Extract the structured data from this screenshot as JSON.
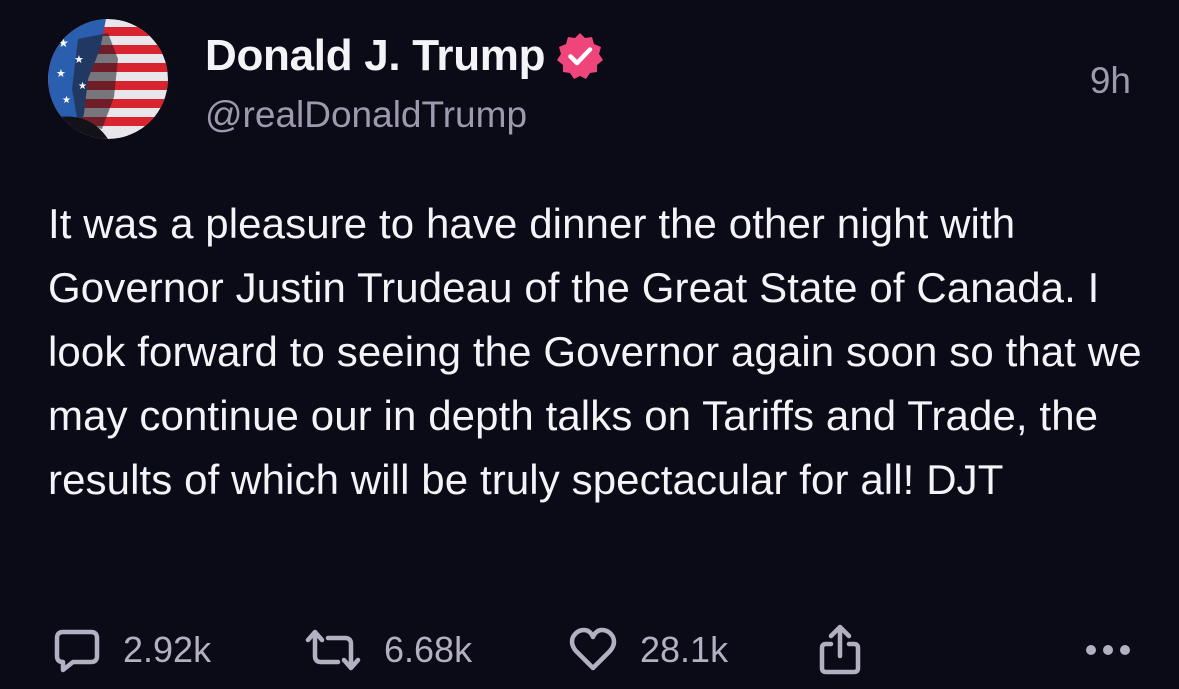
{
  "post": {
    "author": {
      "display_name": "Donald J. Trump",
      "handle": "@realDonaldTrump",
      "verified": true
    },
    "time": "9h",
    "text": "It was a pleasure to have dinner the other night with Governor Justin Trudeau of the Great State of Canada. I look forward to seeing the Governor again soon so that we may continue our in depth talks on Tariffs and Trade, the results of which will be truly spectacular for all! DJT",
    "actions": {
      "replies": "2.92k",
      "reposts": "6.68k",
      "likes": "28.1k"
    }
  },
  "colors": {
    "background": "#0b0a17",
    "primary_text": "#f4f3f8",
    "secondary_text": "#9d9aae",
    "verified_badge": "#f0457a"
  },
  "icons": {
    "reply": "speech-bubble-icon",
    "repost": "repost-arrows-icon",
    "like": "heart-icon",
    "share": "share-icon",
    "more": "ellipsis-icon",
    "verified": "verified-badge-icon"
  }
}
